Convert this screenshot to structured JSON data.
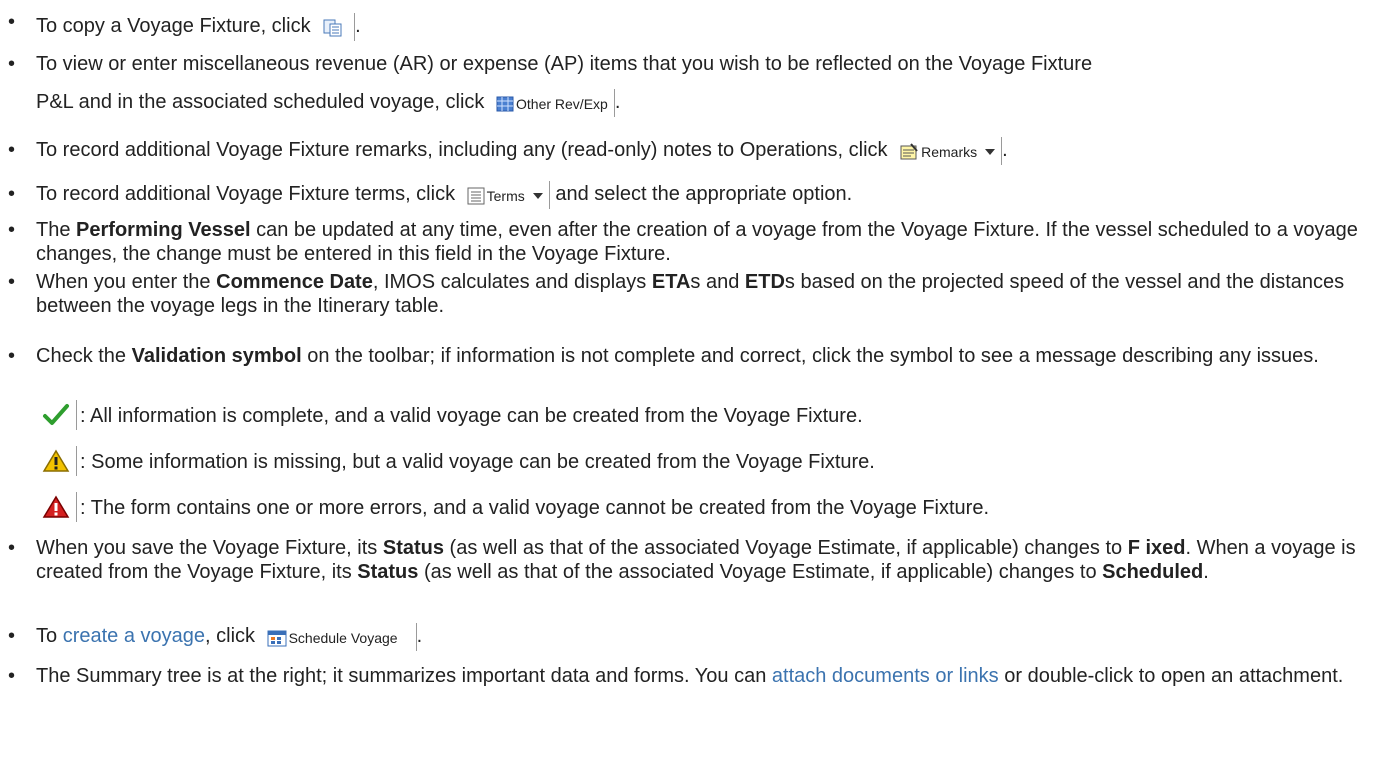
{
  "bullets": {
    "b1": {
      "pre": "To copy a Voyage Fixture, click",
      "post": "."
    },
    "b2": {
      "line1": "To view or enter miscellaneous revenue (AR) or expense (AP) items that you wish to be reflected on the Voyage Fixture",
      "line2_pre": "P&L and in the associated scheduled voyage, click",
      "button": "Other Rev/Exp",
      "post": "."
    },
    "b3": {
      "pre": "To record additional Voyage Fixture remarks, including any (read-only) notes to Operations, click",
      "button": "Remarks",
      "post": "."
    },
    "b4": {
      "pre": "To record additional Voyage Fixture terms, click",
      "button": "Terms",
      "post": "and select the appropriate option."
    },
    "b5": {
      "pre": "The",
      "bold": "Performing Vessel",
      "post": "can be updated at any time, even after the creation of a voyage from the Voyage Fixture. If the vessel scheduled to a voyage changes, the change must be entered in this field in the Voyage Fixture."
    },
    "b6": {
      "pre": "When you enter the",
      "bold1": "Commence Date",
      "mid1": ", IMOS calculates and displays",
      "bold2": "ETA",
      "mid2": "s and",
      "bold3": "ETD",
      "post": "s based on the projected speed of the vessel and the distances between the voyage legs in the Itinerary table."
    },
    "b7": {
      "pre": "Check the",
      "bold": "Validation symbol",
      "post": "on the toolbar; if information is not complete and correct, click the symbol to see a message describing any issues."
    },
    "b8": {
      "pre": "When you save the Voyage Fixture, its",
      "bold1": "Status",
      "mid1": "(as well as that of the associated Voyage Estimate, if applicable) changes to",
      "bold2": "F ixed",
      "mid2": ". When a voyage is created from the Voyage Fixture, its",
      "bold3": "Status",
      "mid3": "(as well as that of the associated Voyage Estimate, if applicable) changes to",
      "bold4": "Scheduled",
      "post": "."
    },
    "b9": {
      "link": "create a voyage",
      "pre": "To",
      "mid": ", click",
      "button": "Schedule Voyage",
      "post": "."
    },
    "b10": {
      "pre": "The Summary tree is at the right; it summarizes important data and forms. You can",
      "link": "attach documents or links",
      "post": "or double-click to open an attachment."
    }
  },
  "validation": {
    "valid": ": All information is complete, and a valid voyage can be created from the Voyage Fixture.",
    "warning": ": Some information is missing, but a valid voyage can be created from the Voyage Fixture.",
    "error": ": The form contains one or more errors, and a valid voyage cannot be created from the Voyage Fixture."
  },
  "icons": {
    "copy": "copy-icon",
    "other_rev_exp": "grid-table-icon",
    "remarks": "notepad-icon",
    "terms": "list-icon",
    "valid": "checkmark-icon",
    "warning": "warning-triangle-icon",
    "error": "error-triangle-icon",
    "schedule": "calendar-icon"
  },
  "colors": {
    "link": "#3b73af",
    "check": "#2e9e2e",
    "warning": "#f2c200",
    "error": "#d42020"
  }
}
